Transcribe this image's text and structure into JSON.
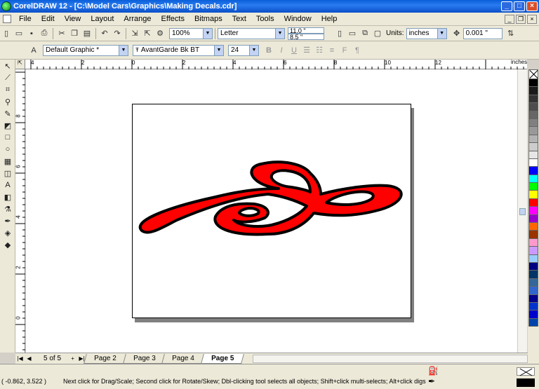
{
  "window": {
    "title": "CorelDRAW 12 - [C:\\Model Cars\\Graphics\\Making Decals.cdr]",
    "controls": [
      "_",
      "□",
      "×"
    ]
  },
  "menu": [
    "File",
    "Edit",
    "View",
    "Layout",
    "Arrange",
    "Effects",
    "Bitmaps",
    "Text",
    "Tools",
    "Window",
    "Help"
  ],
  "toolbar_std": {
    "zoom": "100%",
    "paper": "Letter",
    "width": "11.0 \"",
    "height": "8.5 \"",
    "units_label": "Units:",
    "units": "inches",
    "nudge": "0.001 \"",
    "icons": [
      "new-icon",
      "open-icon",
      "save-icon",
      "print-icon",
      "cut-icon",
      "copy-icon",
      "paste-icon",
      "undo-icon",
      "redo-icon",
      "import-icon",
      "export-icon"
    ]
  },
  "toolbar_text": {
    "style": "Default Graphic *",
    "font": "AvantGarde Bk BT",
    "size": "24"
  },
  "ruler": {
    "units": "inches",
    "h_labels": [
      "4",
      "2",
      "0",
      "2",
      "4",
      "6",
      "8",
      "10",
      "12"
    ],
    "v_labels": [
      "8",
      "6",
      "4",
      "2",
      "0"
    ]
  },
  "palette": [
    "#000000",
    "#1a1a1a",
    "#333333",
    "#4d4d4d",
    "#666666",
    "#808080",
    "#999999",
    "#b3b3b3",
    "#cccccc",
    "#e6e6e6",
    "#ffffff",
    "#0000ff",
    "#00ffff",
    "#00ff00",
    "#ffff00",
    "#ff0000",
    "#ff00ff",
    "#9900cc",
    "#ff6600",
    "#993300",
    "#ff99cc",
    "#cc99ff",
    "#99ccff",
    "#000080",
    "#003366",
    "#336699",
    "#3366cc",
    "#00008b",
    "#0033cc",
    "#0000cd",
    "#0044aa"
  ],
  "shape": {
    "fill": "#ff0000",
    "outline": "#000000"
  },
  "pages": {
    "counter": "5 of 5",
    "tabs": [
      "Page 2",
      "Page 3",
      "Page 4",
      "Page 5"
    ],
    "active": "Page 5"
  },
  "status": {
    "coords": "( -0.862, 3.522 )",
    "hint": "Next click for Drag/Scale; Second click for Rotate/Skew; Dbl-clicking tool selects all objects; Shift+click multi-selects; Alt+click digs"
  }
}
